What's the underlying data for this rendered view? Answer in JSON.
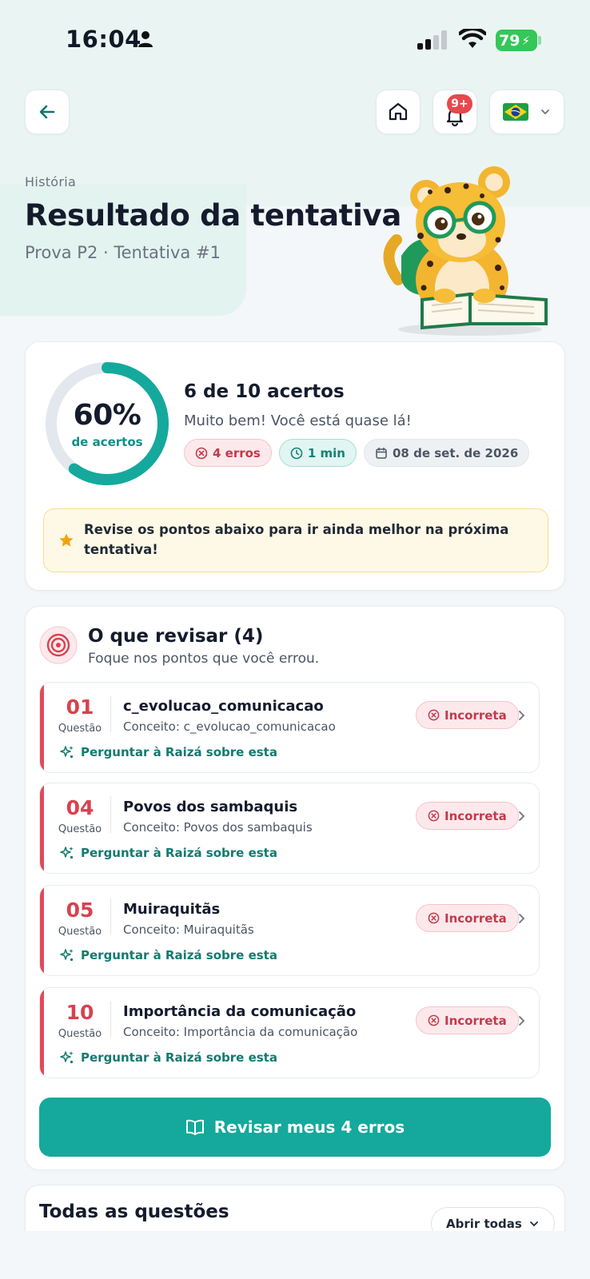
{
  "status_bar": {
    "time": "16:04",
    "battery": "79",
    "icons": [
      "person-icon",
      "signal-icon",
      "wifi-icon",
      "battery-icon"
    ]
  },
  "header": {
    "back_icon": "arrow-left-icon",
    "home_icon": "home-icon",
    "bell_icon": "bell-icon",
    "notifications_badge": "9+",
    "language_flag": "brazil-flag-icon"
  },
  "page": {
    "subject": "História",
    "title": "Resultado da tentativa",
    "subtitle": "Prova P2 · Tentativa #1"
  },
  "score": {
    "percent_text": "60%",
    "percent_value": 0.6,
    "percent_label": "de acertos",
    "title": "6 de 10 acertos",
    "message": "Muito bem! Você está quase lá!",
    "chips": {
      "errors": "4 erros",
      "time": "1 min",
      "date": "08 de set. de 2026"
    },
    "tip": "Revise os pontos abaixo para ir ainda melhor na próxima tentativa!"
  },
  "review": {
    "title": "O que revisar (4)",
    "subtitle": "Foque nos pontos que você errou.",
    "number_label": "Questão",
    "ask_label": "Perguntar à Raizá sobre esta",
    "status_label": "Incorreta",
    "items": [
      {
        "number": "01",
        "title": "c_evolucao_comunicacao",
        "concept": "Conceito: c_evolucao_comunicacao"
      },
      {
        "number": "04",
        "title": "Povos dos sambaquis",
        "concept": "Conceito: Povos dos sambaquis"
      },
      {
        "number": "05",
        "title": "Muiraquitãs",
        "concept": "Conceito: Muiraquitãs"
      },
      {
        "number": "10",
        "title": "Importância da comunicação",
        "concept": "Conceito: Importância da comunicação"
      }
    ],
    "cta": "Revisar meus 4 erros"
  },
  "all_questions": {
    "title": "Todas as questões",
    "open_all": "Abrir todas"
  },
  "colors": {
    "accent": "#14a99c",
    "error": "#d9414f",
    "background": "#f3f7f9"
  }
}
